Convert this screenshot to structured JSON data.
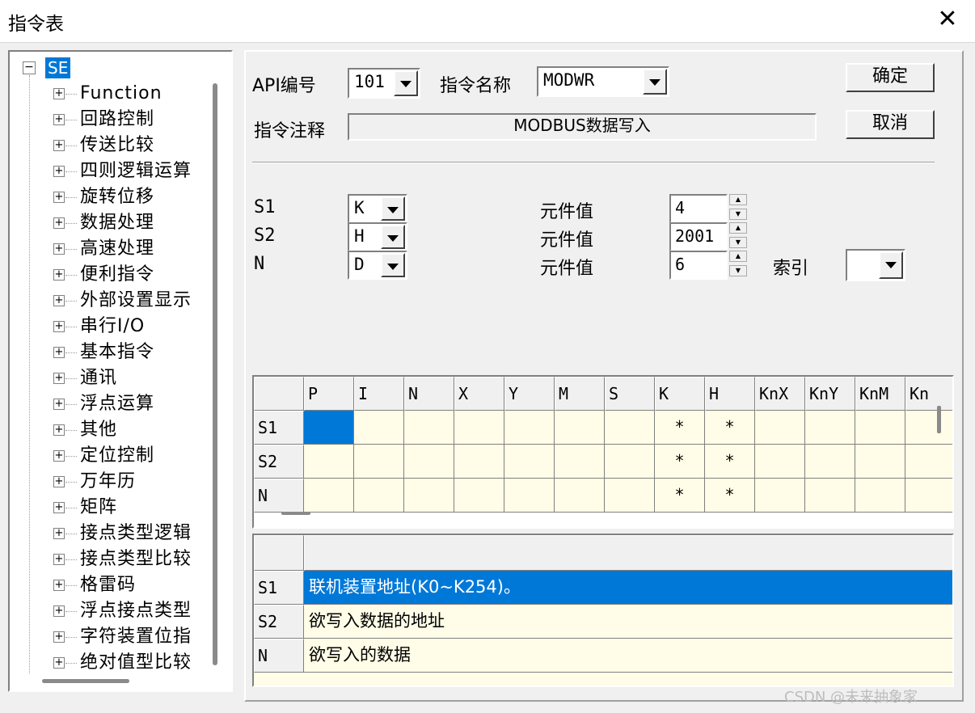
{
  "window": {
    "title": "指令表",
    "close_glyph": "✕"
  },
  "tree": {
    "root_label": "SE",
    "items": [
      "Function",
      "回路控制",
      "传送比较",
      "四则逻辑运算",
      "旋转位移",
      "数据处理",
      "高速处理",
      "便利指令",
      "外部设置显示",
      "串行I/O",
      "基本指令",
      "通讯",
      "浮点运算",
      "其他",
      "定位控制",
      "万年历",
      "矩阵",
      "接点类型逻辑",
      "接点类型比较",
      "格雷码",
      "浮点接点类型",
      "字符装置位指",
      "绝对值型比较"
    ]
  },
  "form": {
    "api_label": "API编号",
    "api_value": "101",
    "name_label": "指令名称",
    "name_value": "MODWR",
    "ok_label": "确定",
    "cancel_label": "取消",
    "note_label": "指令注释",
    "note_value": "MODBUS数据写入",
    "operands": [
      {
        "name": "S1",
        "type": "K",
        "value_label": "元件值",
        "value": "4"
      },
      {
        "name": "S2",
        "type": "H",
        "value_label": "元件值",
        "value": "2001"
      },
      {
        "name": "N",
        "type": "D",
        "value_label": "元件值",
        "value": "6"
      }
    ],
    "index_label": "索引",
    "index_value": ""
  },
  "device_table": {
    "columns": [
      "P",
      "I",
      "N",
      "X",
      "Y",
      "M",
      "S",
      "K",
      "H",
      "KnX",
      "KnY",
      "KnM",
      "Kn"
    ],
    "rows": [
      {
        "name": "S1",
        "cells": [
          "",
          "",
          "",
          "",
          "",
          "",
          "",
          "*",
          "*",
          "",
          "",
          "",
          ""
        ]
      },
      {
        "name": "S2",
        "cells": [
          "",
          "",
          "",
          "",
          "",
          "",
          "",
          "*",
          "*",
          "",
          "",
          "",
          ""
        ]
      },
      {
        "name": "N",
        "cells": [
          "",
          "",
          "",
          "",
          "",
          "",
          "",
          "*",
          "*",
          "",
          "",
          "",
          ""
        ]
      }
    ]
  },
  "desc_table": {
    "header": [
      "",
      ""
    ],
    "rows": [
      {
        "name": "S1",
        "desc": "联机装置地址(K0~K254)。"
      },
      {
        "name": "S2",
        "desc": "欲写入数据的地址"
      },
      {
        "name": "N",
        "desc": "欲写入的数据"
      }
    ]
  },
  "watermark": "CSDN @未来抽象家",
  "colors": {
    "selection": "#0078d7",
    "cell_bg": "#fffde7"
  }
}
